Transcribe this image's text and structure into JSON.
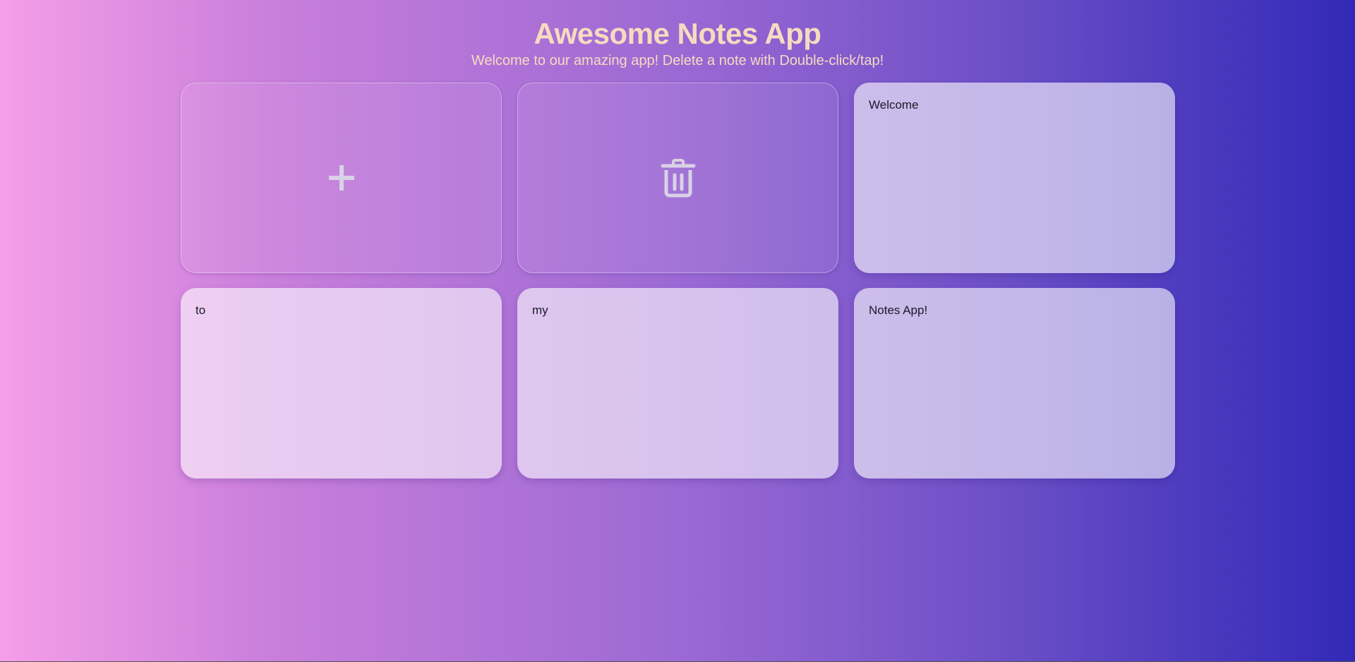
{
  "header": {
    "title": "Awesome Notes App",
    "subtitle": "Welcome to our amazing app! Delete a note with Double-click/tap!"
  },
  "actions": {
    "add_icon": "plus-icon",
    "delete_icon": "trash-icon"
  },
  "notes": [
    {
      "text": "Welcome"
    },
    {
      "text": "to"
    },
    {
      "text": "my"
    },
    {
      "text": "Notes App!"
    }
  ],
  "colors": {
    "title": "#f6dbbf",
    "gradient_start": "#f59ee8",
    "gradient_end": "#3229b8"
  }
}
